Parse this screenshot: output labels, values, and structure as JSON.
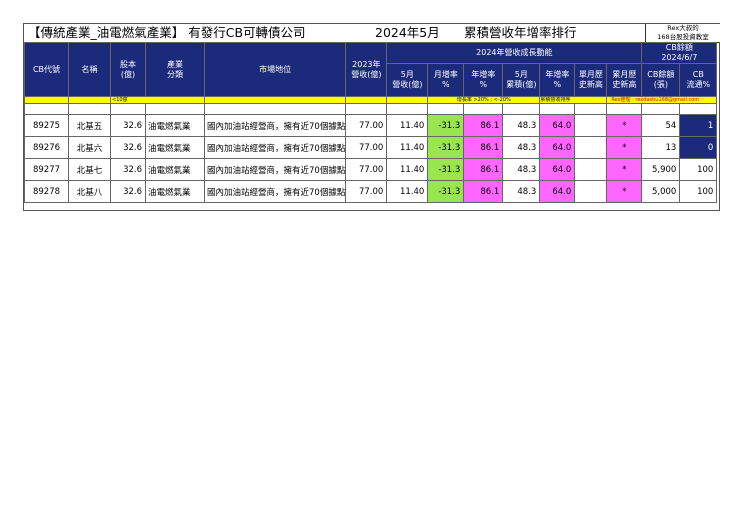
{
  "title": {
    "main": "【傳統產業_油電燃氣產業】 有發行CB可轉債公司",
    "period": "2024年5月",
    "rank": "累積營收年增率排行"
  },
  "brand": {
    "line1": "Rex大叔的",
    "line2": "168台股投資教室"
  },
  "headers": {
    "code": "CB代號",
    "name": "名稱",
    "capital": "股本\n(億)",
    "industry": "產業\n分類",
    "market_position": "市場地位",
    "rev2023": "2023年\n營收(億)",
    "growth_group": "2024年營收成長動能",
    "cb_balance_group": "CB餘額\n2024/6/7",
    "may_rev": "5月\n營收(億)",
    "mom": "月增率\n%",
    "yoy": "年增率\n%",
    "may_cum": "5月\n累積(億)",
    "cum_yoy": "年增率\n%",
    "single_high": "單月歷\n史新高",
    "cum_high": "累月歷\n史新高",
    "cb_amount": "CB餘額\n(張)",
    "cb_circ": "CB\n流通%"
  },
  "legend": {
    "capital_note": "<10億",
    "growth_note": "增長率 >20% ; <-20%",
    "cum_note": "累積營收排序",
    "email": "Rex整理 : rexdashu168@gmail.com"
  },
  "rows": [
    {
      "code": "89275",
      "name": "北基五",
      "capital": "32.6",
      "industry": "油電燃氣業",
      "position": "國內加油站經營商，擁有近70個據點",
      "rev2023": "77.00",
      "may_rev": "11.40",
      "mom": "-31.3",
      "yoy": "86.1",
      "may_cum": "48.3",
      "cum_yoy": "64.0",
      "single_high": "",
      "cum_high": "*",
      "cb_amount": "54",
      "cb_circ": "1"
    },
    {
      "code": "89276",
      "name": "北基六",
      "capital": "32.6",
      "industry": "油電燃氣業",
      "position": "國內加油站經營商，擁有近70個據點",
      "rev2023": "77.00",
      "may_rev": "11.40",
      "mom": "-31.3",
      "yoy": "86.1",
      "may_cum": "48.3",
      "cum_yoy": "64.0",
      "single_high": "",
      "cum_high": "*",
      "cb_amount": "13",
      "cb_circ": "0"
    },
    {
      "code": "89277",
      "name": "北基七",
      "capital": "32.6",
      "industry": "油電燃氣業",
      "position": "國內加油站經營商，擁有近70個據點",
      "rev2023": "77.00",
      "may_rev": "11.40",
      "mom": "-31.3",
      "yoy": "86.1",
      "may_cum": "48.3",
      "cum_yoy": "64.0",
      "single_high": "",
      "cum_high": "*",
      "cb_amount": "5,900",
      "cb_circ": "100"
    },
    {
      "code": "89278",
      "name": "北基八",
      "capital": "32.6",
      "industry": "油電燃氣業",
      "position": "國內加油站經營商，擁有近70個據點",
      "rev2023": "77.00",
      "may_rev": "11.40",
      "mom": "-31.3",
      "yoy": "86.1",
      "may_cum": "48.3",
      "cum_yoy": "64.0",
      "single_high": "",
      "cum_high": "*",
      "cb_amount": "5,000",
      "cb_circ": "100"
    }
  ],
  "colors": {
    "header_bg": "#1b2a7a",
    "legend_bar": "#ffff00",
    "growth_green": "#99e550",
    "highlight_magenta": "#ff66ff"
  }
}
